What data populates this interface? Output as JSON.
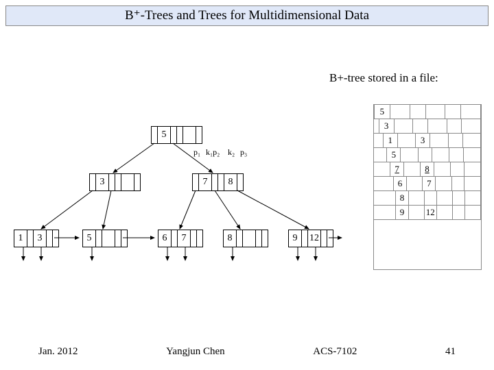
{
  "title": "B⁺-Trees and Trees for Multidimensional Data",
  "caption": "B+-tree stored in a file:",
  "footer": {
    "date": "Jan. 2012",
    "author": "Yangjun Chen",
    "course": "ACS-7102",
    "page": "41"
  },
  "tree": {
    "root": {
      "v": "5"
    },
    "labels": {
      "p1": "p₁",
      "k1p2": "k₁p₂",
      "k2": "k₂",
      "p3": "p₃"
    },
    "mid": [
      {
        "v": "3"
      },
      {
        "v": "7"
      },
      {
        "v": "8"
      }
    ],
    "leaves": [
      "1",
      "3",
      "5",
      "6",
      "7",
      "8",
      "9",
      "12"
    ]
  },
  "file": {
    "rows": [
      [
        "5",
        "",
        "",
        "",
        "",
        ""
      ],
      [
        "3",
        "",
        "",
        "",
        "",
        ""
      ],
      [
        "1",
        "",
        "3",
        "",
        "",
        ""
      ],
      [
        "5",
        "",
        "",
        "",
        "",
        ""
      ],
      [
        "7",
        "",
        "8",
        "",
        "",
        ""
      ],
      [
        "6",
        "",
        "7",
        "",
        "",
        ""
      ],
      [
        "8",
        "",
        "",
        "",
        "",
        ""
      ],
      [
        "9",
        "",
        "12",
        "",
        "",
        ""
      ]
    ],
    "underline_cols": [
      [],
      [],
      [],
      [],
      [
        0,
        2
      ],
      [],
      [],
      []
    ]
  },
  "chart_data": {
    "type": "diagram",
    "description": "B+-tree with root [5]; internal nodes [3] and [7,8]; leaf nodes [1,3],[5],[6,7],[8],[9,12]; plus file-page representation of the same tree",
    "root_keys": [
      5
    ],
    "internal_nodes": [
      [
        3
      ],
      [
        7,
        8
      ]
    ],
    "leaf_values": [
      [
        1,
        3
      ],
      [
        5
      ],
      [
        6,
        7
      ],
      [
        8
      ],
      [
        9,
        12
      ]
    ],
    "file_pages": [
      [
        5
      ],
      [
        3
      ],
      [
        1,
        3
      ],
      [
        5
      ],
      [
        7,
        8
      ],
      [
        6,
        7
      ],
      [
        8
      ],
      [
        9,
        12
      ]
    ]
  }
}
